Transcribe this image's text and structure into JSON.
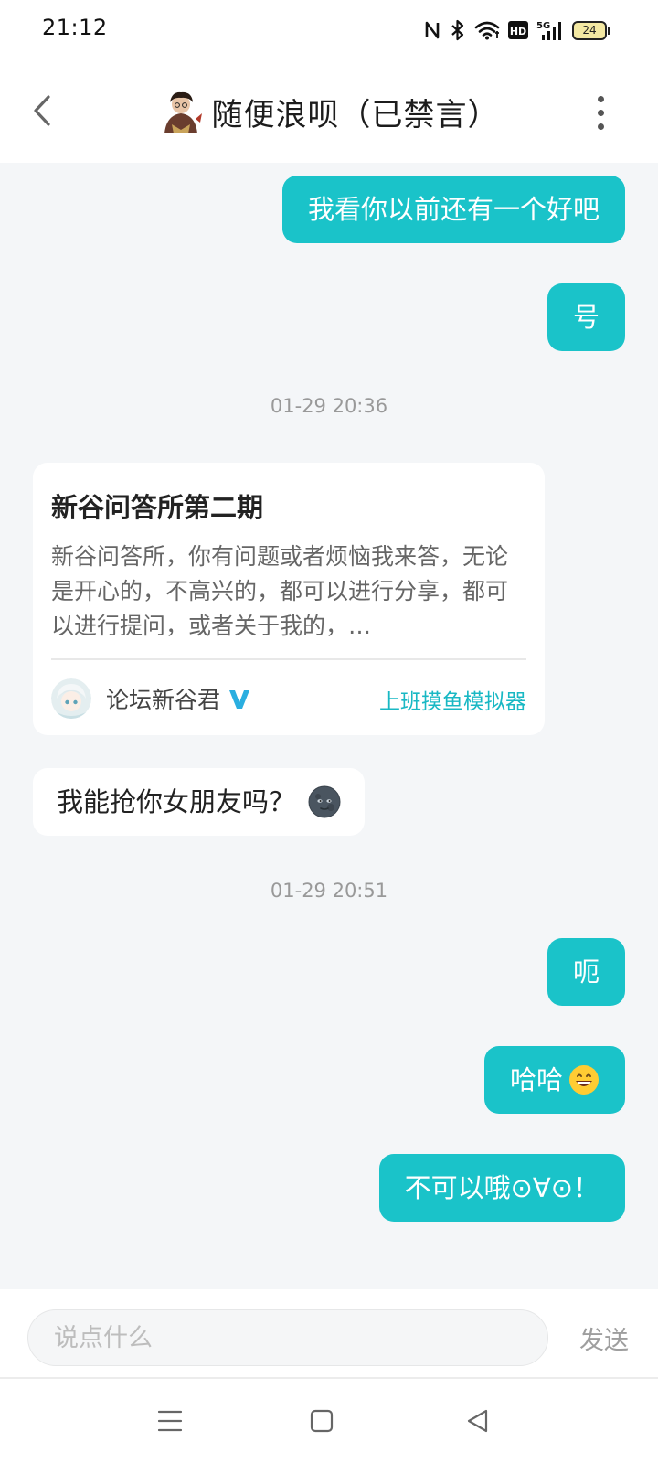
{
  "status_bar": {
    "time": "21:12",
    "battery_level": "24",
    "icons": [
      "nfc-icon",
      "bluetooth-icon",
      "wifi-icon",
      "hd-icon",
      "signal-5g-icon",
      "battery-icon"
    ]
  },
  "header": {
    "title": "随便浪呗（已禁言）",
    "back_icon": "chevron-left-icon",
    "more_icon": "more-vertical-icon"
  },
  "messages": [
    {
      "side": "out",
      "text": "我看你以前还有一个好吧"
    },
    {
      "side": "out",
      "text": "号"
    },
    {
      "timestamp": "01-29 20:36"
    },
    {
      "side": "in",
      "card": {
        "title": "新谷问答所第二期",
        "body": "新谷问答所，你有问题或者烦恼我来答，无论是开心的，不高兴的，都可以进行分享，都可以进行提问，或者关于我的，…",
        "author": "论坛新谷君",
        "tag": "上班摸鱼模拟器"
      }
    },
    {
      "side": "in",
      "text": "我能抢你女朋友吗？",
      "emoji": "new-moon-face"
    },
    {
      "timestamp": "01-29 20:51"
    },
    {
      "side": "out",
      "text": "呃"
    },
    {
      "side": "out",
      "text": "哈哈",
      "emoji": "grinning-face"
    },
    {
      "side": "out",
      "text": "不可以哦⊙∀⊙！"
    }
  ],
  "input": {
    "placeholder": "说点什么",
    "value": "",
    "send_label": "发送"
  },
  "colors": {
    "accent": "#1ac3c9",
    "chat_background": "#f4f6f8",
    "link": "#19b8c4"
  }
}
